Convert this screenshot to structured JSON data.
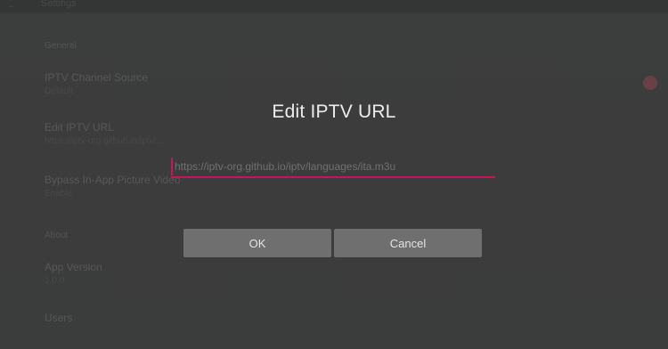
{
  "background": {
    "header": {
      "back_glyph": "←",
      "title": "Settings"
    },
    "section_general": "General",
    "items": [
      {
        "title": "IPTV Channel Source",
        "subtitle": "Default"
      },
      {
        "title": "Edit IPTV URL",
        "subtitle": "https://iptv-org.github.io/iptv/..."
      },
      {
        "title": "Bypass In-App Picture Video",
        "subtitle": "Enable"
      }
    ],
    "section_about": "About",
    "about_items": [
      {
        "title": "App Version",
        "subtitle": "1.0.0"
      },
      {
        "title": "Users",
        "subtitle": ""
      }
    ]
  },
  "dialog": {
    "title": "Edit IPTV URL",
    "url_value": "https://iptv-org.github.io/iptv/languages/ita.m3u",
    "ok_label": "OK",
    "cancel_label": "Cancel",
    "accent_color": "#c2185b"
  }
}
